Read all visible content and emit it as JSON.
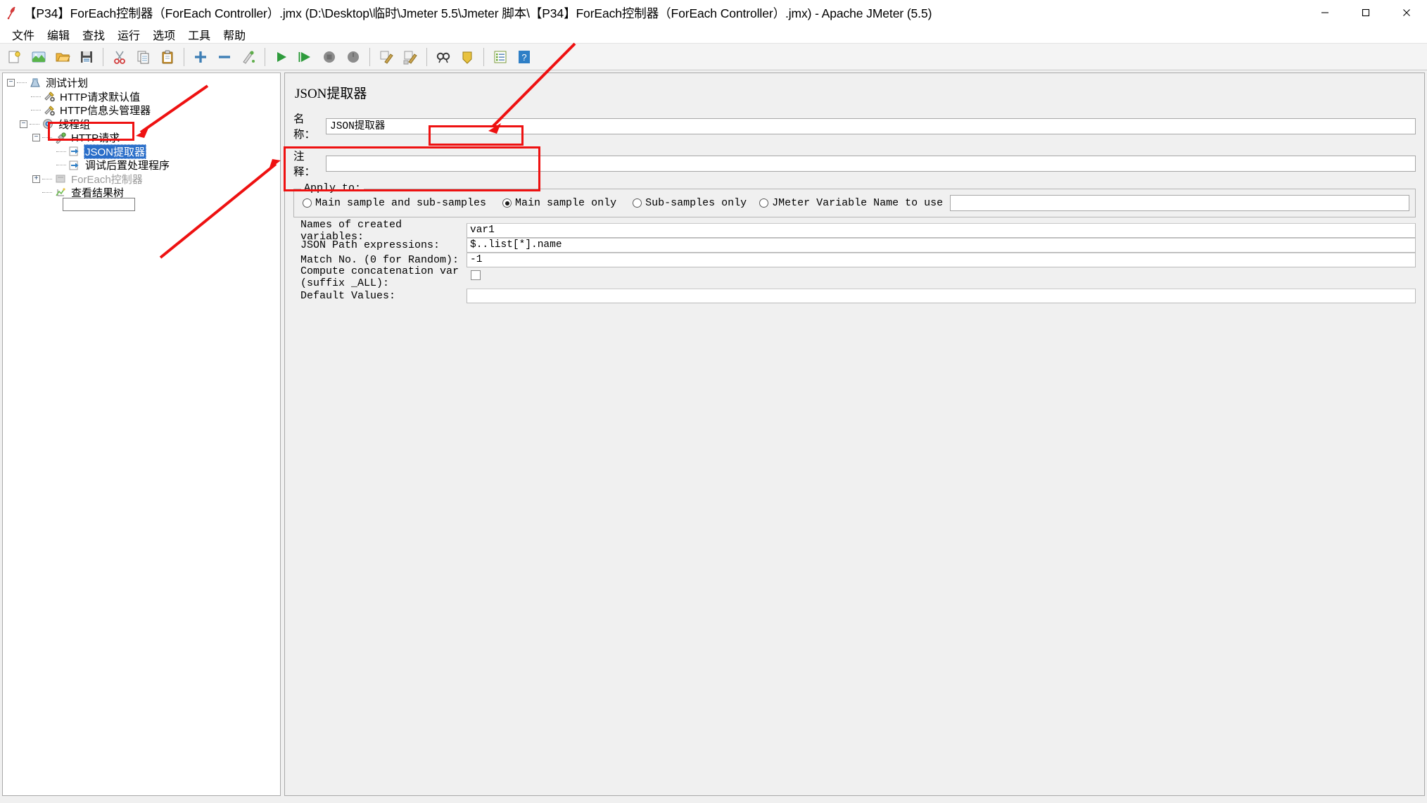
{
  "window": {
    "title": "【P34】ForEach控制器（ForEach Controller）.jmx (D:\\Desktop\\临时\\Jmeter 5.5\\Jmeter 脚本\\【P34】ForEach控制器（ForEach Controller）.jmx) - Apache JMeter (5.5)",
    "app_icon": "jmeter-feather-icon",
    "controls": {
      "minimize": "minimize-icon",
      "maximize": "maximize-icon",
      "close": "close-icon"
    }
  },
  "menubar": {
    "items": [
      {
        "label": "文件",
        "name": "menu-file"
      },
      {
        "label": "编辑",
        "name": "menu-edit"
      },
      {
        "label": "查找",
        "name": "menu-search"
      },
      {
        "label": "运行",
        "name": "menu-run"
      },
      {
        "label": "选项",
        "name": "menu-options"
      },
      {
        "label": "工具",
        "name": "menu-tools"
      },
      {
        "label": "帮助",
        "name": "menu-help"
      }
    ]
  },
  "toolbar": {
    "buttons": [
      {
        "name": "new-icon",
        "title": "新建"
      },
      {
        "name": "templates-icon",
        "title": "模板"
      },
      {
        "name": "open-icon",
        "title": "打开"
      },
      {
        "name": "save-icon",
        "title": "保存"
      },
      {
        "name": "cut-icon",
        "title": "剪切"
      },
      {
        "name": "copy-icon",
        "title": "复制"
      },
      {
        "name": "paste-icon",
        "title": "粘贴"
      },
      {
        "name": "expand-all-icon",
        "title": "展开全部"
      },
      {
        "name": "collapse-all-icon",
        "title": "收起全部"
      },
      {
        "name": "toggle-icon",
        "title": "切换"
      },
      {
        "name": "start-icon",
        "title": "启动"
      },
      {
        "name": "start-no-pauses-icon",
        "title": "无间隔启动"
      },
      {
        "name": "stop-icon",
        "title": "停止"
      },
      {
        "name": "shutdown-icon",
        "title": "关闭"
      },
      {
        "name": "clear-icon",
        "title": "清除"
      },
      {
        "name": "clear-all-icon",
        "title": "清除全部"
      },
      {
        "name": "search-icon",
        "title": "查找"
      },
      {
        "name": "search-reset-icon",
        "title": "重置查找"
      },
      {
        "name": "function-helper-icon",
        "title": "函数助手"
      },
      {
        "name": "help-icon",
        "title": "帮助"
      }
    ]
  },
  "tree": {
    "nodes": [
      {
        "label": "测试计划",
        "icon": "test-plan-icon",
        "depth": 0,
        "expander": "minus",
        "selected": false,
        "disabled": false,
        "name": "tree-node-test-plan"
      },
      {
        "label": "HTTP请求默认值",
        "icon": "config-element-icon",
        "depth": 1,
        "expander": "none",
        "selected": false,
        "disabled": false,
        "name": "tree-node-http-request-defaults"
      },
      {
        "label": "HTTP信息头管理器",
        "icon": "config-element-icon",
        "depth": 1,
        "expander": "none",
        "selected": false,
        "disabled": false,
        "name": "tree-node-http-header-manager"
      },
      {
        "label": "线程组",
        "icon": "thread-group-icon",
        "depth": 1,
        "expander": "minus",
        "selected": false,
        "disabled": false,
        "name": "tree-node-thread-group"
      },
      {
        "label": "HTTP请求",
        "icon": "http-sampler-icon",
        "depth": 2,
        "expander": "minus",
        "selected": false,
        "disabled": false,
        "name": "tree-node-http-request"
      },
      {
        "label": "JSON提取器",
        "icon": "post-processor-icon",
        "depth": 3,
        "expander": "none",
        "selected": true,
        "disabled": false,
        "name": "tree-node-json-extractor"
      },
      {
        "label": "调试后置处理程序",
        "icon": "post-processor-icon",
        "depth": 3,
        "expander": "none",
        "selected": false,
        "disabled": false,
        "name": "tree-node-debug-post-processor"
      },
      {
        "label": "ForEach控制器",
        "icon": "logic-controller-icon",
        "depth": 2,
        "expander": "plus",
        "selected": false,
        "disabled": true,
        "name": "tree-node-foreach-controller"
      },
      {
        "label": "查看结果树",
        "icon": "view-results-tree-icon",
        "depth": 2,
        "expander": "none",
        "selected": false,
        "disabled": false,
        "name": "tree-node-view-results-tree"
      }
    ]
  },
  "detail": {
    "panel_title": "JSON提取器",
    "name_row": {
      "label": "名称：",
      "value": "JSON提取器"
    },
    "comment_row": {
      "label": "注释：",
      "value": "",
      "placeholder": ""
    },
    "apply_to": {
      "group_title": "Apply to:",
      "options": [
        {
          "label": "Main sample and sub-samples",
          "selected": false,
          "name": "radio-main-and-sub"
        },
        {
          "label": "Main sample only",
          "selected": true,
          "name": "radio-main-only"
        },
        {
          "label": "Sub-samples only",
          "selected": false,
          "name": "radio-sub-only"
        },
        {
          "label": "JMeter Variable Name to use",
          "selected": false,
          "name": "radio-jmeter-variable"
        }
      ],
      "variable_value": ""
    },
    "fields": [
      {
        "label": "Names of created variables:",
        "value": "var1",
        "name": "field-names-of-created-variables"
      },
      {
        "label": "JSON Path expressions:",
        "value": "$..list[*].name",
        "name": "field-json-path-expressions"
      },
      {
        "label": "Match No. (0 for Random):",
        "value": "-1",
        "name": "field-match-no"
      }
    ],
    "concat": {
      "label": "Compute concatenation var (suffix _ALL):",
      "checked": false,
      "name": "field-compute-concatenation"
    },
    "default_values": {
      "label": "Default Values:",
      "value": "",
      "name": "field-default-values"
    }
  },
  "annotations": {
    "color": "#ee1111",
    "boxes": [
      {
        "name": "highlight-tree-json-extractor"
      },
      {
        "name": "highlight-main-sample-only"
      },
      {
        "name": "highlight-extractor-fields"
      }
    ],
    "arrows": [
      {
        "name": "arrow-to-main-sample-only"
      },
      {
        "name": "arrow-to-tree-json-extractor"
      },
      {
        "name": "arrow-to-extractor-fields"
      }
    ]
  }
}
